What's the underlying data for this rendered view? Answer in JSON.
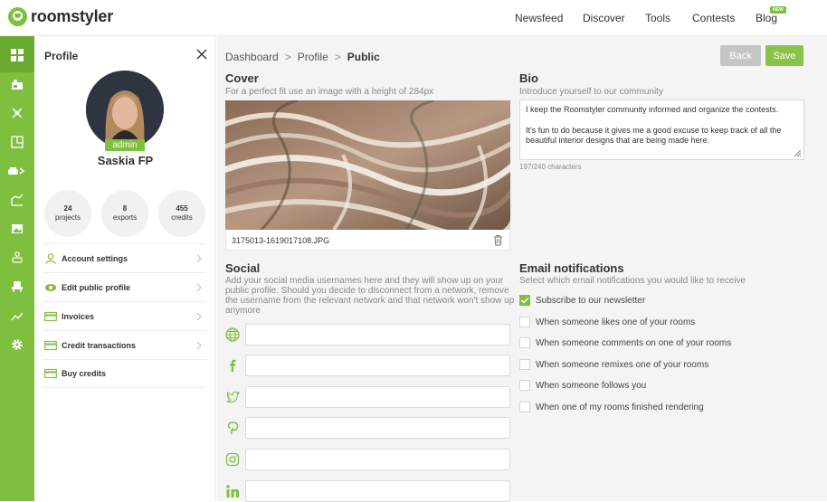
{
  "app": {
    "brand": "roomstyler"
  },
  "topnav": {
    "items": [
      "Newsfeed",
      "Discover",
      "Tools",
      "Contests",
      "Blog"
    ],
    "new_badge": "NEW"
  },
  "rail": {
    "icons": [
      "dashboard-icon",
      "room-icon",
      "floorplan-tools-icon",
      "layout-icon",
      "sofa-move-icon",
      "stats-chart-icon",
      "image-icon",
      "person-sofa-icon",
      "chair-icon",
      "trend-icon",
      "gear-icon"
    ],
    "accent": "#7fbf3f"
  },
  "panel": {
    "title": "Profile",
    "badge": "admin",
    "user_name": "Saskia FP",
    "stats": [
      {
        "num": "24",
        "label": "projects"
      },
      {
        "num": "8",
        "label": "exports"
      },
      {
        "num": "455",
        "label": "credits"
      }
    ],
    "menu": [
      {
        "label": "Account settings",
        "icon": "user-icon"
      },
      {
        "label": "Edit public profile",
        "icon": "eye-icon"
      },
      {
        "label": "Invoices",
        "icon": "card-icon"
      },
      {
        "label": "Credit transactions",
        "icon": "card-icon"
      },
      {
        "label": "Buy credits",
        "icon": "card-icon"
      }
    ]
  },
  "breadcrumb": {
    "items": [
      "Dashboard",
      "Profile",
      "Public"
    ]
  },
  "buttons": {
    "back": "Back",
    "save": "Save"
  },
  "cover": {
    "title": "Cover",
    "subtitle": "For a perfect fit use an image with a height of 284px",
    "filename": "3175013-1619017108.JPG"
  },
  "bio": {
    "title": "Bio",
    "subtitle": "Introduce yourself to our community",
    "paragraph1": "I keep the Roomstyler community informed and organize the contests.",
    "paragraph2": "It's fun to do because it gives me a good excuse to keep track of all the beautiful interior designs that are being made here.",
    "count": "197/240 characters"
  },
  "social": {
    "title": "Social",
    "subtitle": "Add your social media usernames here and they will show up on your public profile. Should you decide to disconnect from a network, remove the username from the relevant network and that network won't show up anymore",
    "fields": [
      {
        "icon": "globe-icon",
        "value": ""
      },
      {
        "icon": "facebook-icon",
        "value": ""
      },
      {
        "icon": "twitter-icon",
        "value": ""
      },
      {
        "icon": "pinterest-icon",
        "value": ""
      },
      {
        "icon": "instagram-icon",
        "value": ""
      },
      {
        "icon": "linkedin-icon",
        "value": ""
      }
    ]
  },
  "email": {
    "title": "Email notifications",
    "subtitle": "Select which email notifications you would like to receive",
    "options": [
      {
        "label": "Subscribe to our newsletter",
        "checked": true
      },
      {
        "label": "When someone likes one of your rooms",
        "checked": false
      },
      {
        "label": "When someone comments on one of your rooms",
        "checked": false
      },
      {
        "label": "When someone remixes one of your rooms",
        "checked": false
      },
      {
        "label": "When someone follows you",
        "checked": false
      },
      {
        "label": "When one of my rooms finished rendering",
        "checked": false
      }
    ]
  }
}
